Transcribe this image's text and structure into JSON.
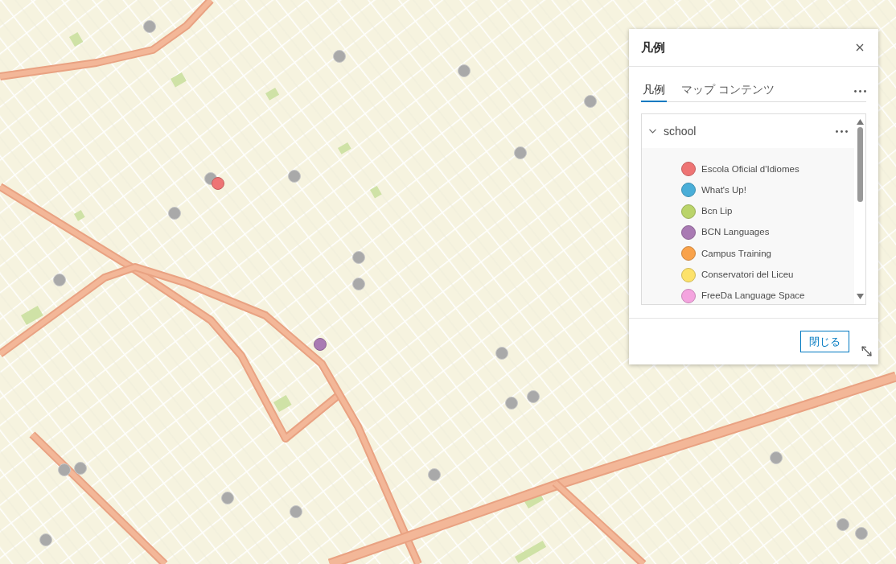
{
  "legend_panel": {
    "title": "凡例",
    "tabs": [
      {
        "label": "凡例",
        "selected": true
      },
      {
        "label": "マップ コンテンツ",
        "selected": false
      }
    ],
    "layer": {
      "name": "school",
      "expanded": true,
      "items": [
        {
          "label": "Escola Oficial d'Idiomes",
          "color": "#ee7474"
        },
        {
          "label": "What's Up!",
          "color": "#4aaed8"
        },
        {
          "label": "Bcn Lip",
          "color": "#bad46a"
        },
        {
          "label": "BCN Languages",
          "color": "#a97ab3"
        },
        {
          "label": "Campus Training",
          "color": "#f9a24a"
        },
        {
          "label": "Conservatori del Liceu",
          "color": "#fde26a"
        },
        {
          "label": "FreeDa Language Space",
          "color": "#f4a4df"
        }
      ]
    },
    "close_button": "閉じる"
  }
}
